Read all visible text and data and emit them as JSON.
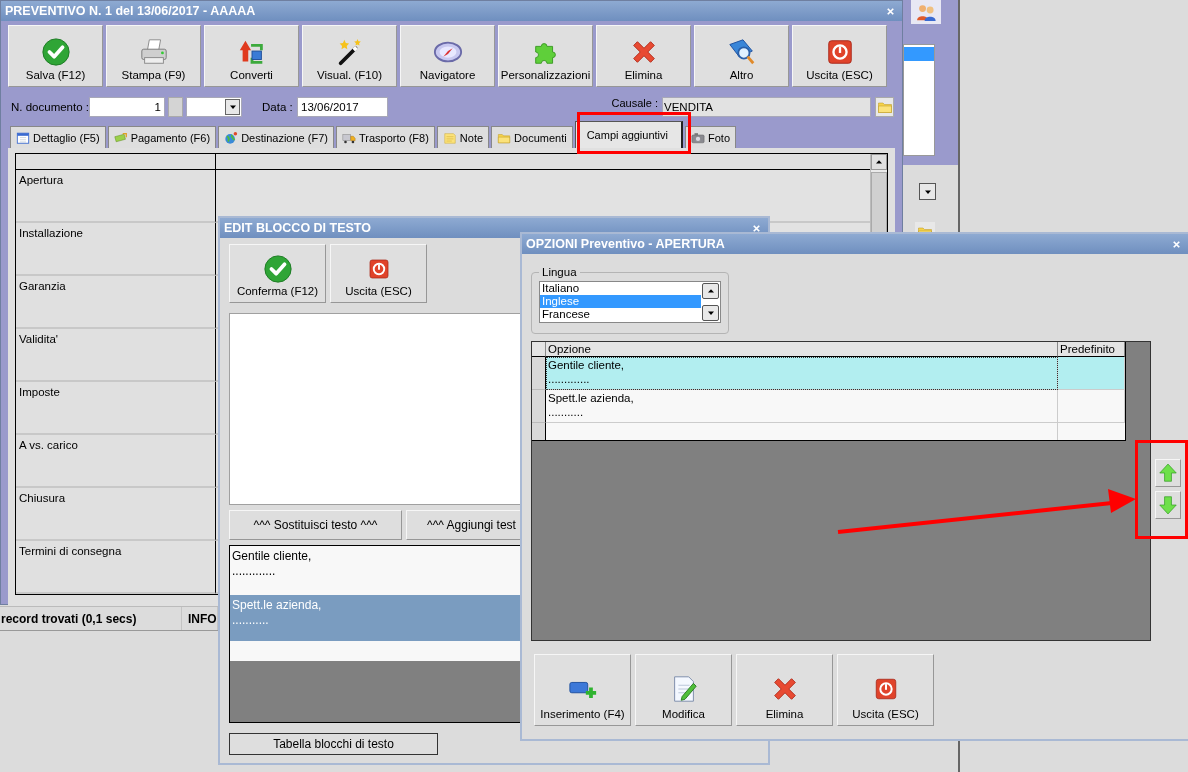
{
  "main_window": {
    "title": "PREVENTIVO N. 1 del 13/06/2017 - AAAAA",
    "toolbar": [
      "Salva (F12)",
      "Stampa (F9)",
      "Converti",
      "Visual. (F10)",
      "Navigatore",
      "Personalizzazioni",
      "Elimina",
      "Altro",
      "Uscita (ESC)"
    ],
    "document_label": "N. documento :",
    "document_number": "1",
    "date_label": "Data :",
    "date": "13/06/2017",
    "causale_label": "Causale :",
    "causale": "VENDITA",
    "tabs": [
      {
        "label": "Dettaglio (F5)",
        "selected": false
      },
      {
        "label": "Pagamento (F6)",
        "selected": false
      },
      {
        "label": "Destinazione (F7)",
        "selected": false
      },
      {
        "label": "Trasporto (F8)",
        "selected": false
      },
      {
        "label": "Note",
        "selected": false
      },
      {
        "label": "Documenti",
        "selected": false
      },
      {
        "label": "Campi aggiuntivi",
        "selected": true
      },
      {
        "label": "Foto",
        "selected": false
      }
    ],
    "fields": [
      "Apertura",
      "Installazione",
      "Garanzia",
      "Validita'",
      "Imposte",
      "A vs. carico",
      "Chiusura",
      "Termini di consegna"
    ],
    "status_bar": [
      "record trovati (0,1 secs)",
      "INFO"
    ]
  },
  "edit_window": {
    "title": "EDIT BLOCCO DI TESTO",
    "buttons": [
      "Conferma (F12)",
      "Uscita (ESC)"
    ],
    "text_buttons": [
      "^^^ Sostituisci testo ^^^",
      "^^^ Aggiungi test"
    ],
    "blocks": [
      {
        "lines": [
          "Gentile cliente,",
          "............."
        ],
        "selected": false
      },
      {
        "lines": [
          "Spett.le azienda,",
          "..........."
        ],
        "selected": true
      }
    ],
    "table_button": "Tabella blocchi di testo"
  },
  "options_window": {
    "title": "OPZIONI Preventivo - APERTURA",
    "language_label": "Lingua",
    "languages": [
      {
        "label": "Italiano",
        "selected": false
      },
      {
        "label": "Inglese",
        "selected": true
      },
      {
        "label": "Francese",
        "selected": false
      }
    ],
    "columns": [
      "Opzione",
      "Predefinito"
    ],
    "rows": [
      {
        "lines": [
          "Gentile cliente,",
          "............."
        ],
        "selected": true
      },
      {
        "lines": [
          "Spett.le azienda,",
          "..........."
        ],
        "selected": false
      }
    ],
    "buttons": [
      "Inserimento (F4)",
      "Modifica",
      "Elimina",
      "Uscita (ESC)"
    ]
  }
}
